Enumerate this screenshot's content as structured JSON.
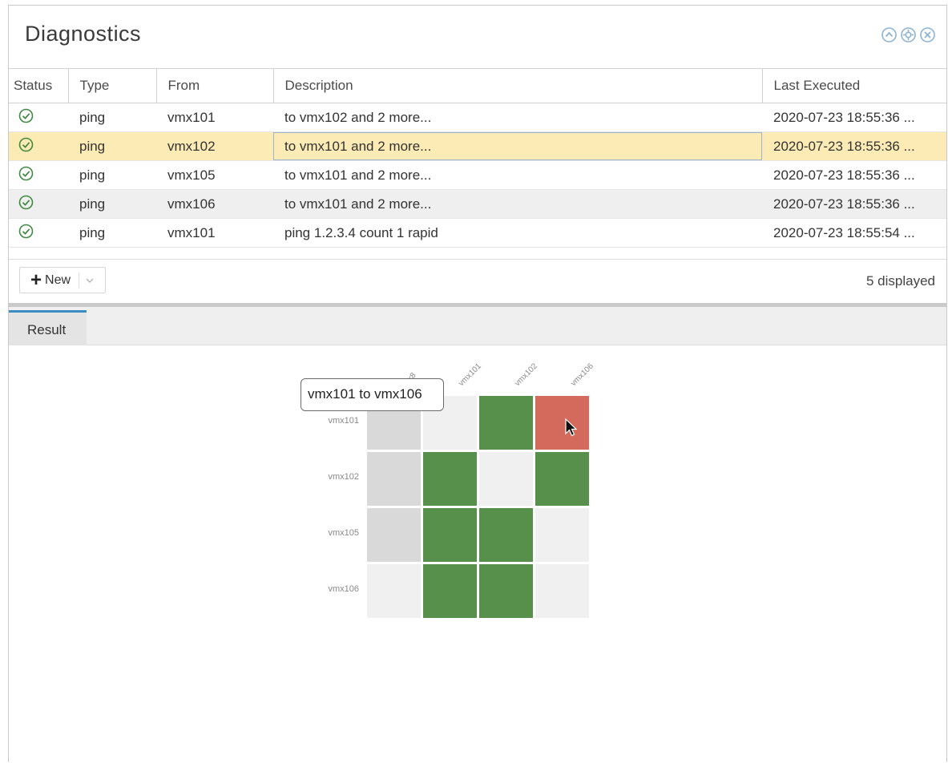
{
  "window": {
    "title": "Diagnostics"
  },
  "window_icons": [
    "collapse-icon",
    "gear-icon",
    "close-icon"
  ],
  "table": {
    "columns": [
      "Status",
      "Type",
      "From",
      "Description",
      "Last Executed"
    ],
    "rows": [
      {
        "status": "check-circle-icon",
        "type": "ping",
        "from": "vmx101",
        "description": "to vmx102 and 2 more...",
        "last_executed": "2020-07-23 18:55:36 ..."
      },
      {
        "status": "check-circle-icon",
        "type": "ping",
        "from": "vmx102",
        "description": "to vmx101 and 2 more...",
        "last_executed": "2020-07-23 18:55:36 ...",
        "selected": true
      },
      {
        "status": "check-circle-icon",
        "type": "ping",
        "from": "vmx105",
        "description": "to vmx101 and 2 more...",
        "last_executed": "2020-07-23 18:55:36 ..."
      },
      {
        "status": "check-circle-icon",
        "type": "ping",
        "from": "vmx106",
        "description": "to vmx101 and 2 more...",
        "last_executed": "2020-07-23 18:55:36 ..."
      },
      {
        "status": "check-circle-icon",
        "type": "ping",
        "from": "vmx101",
        "description": "ping 1.2.3.4 count 1 rapid",
        "last_executed": "2020-07-23 18:55:54 ..."
      }
    ]
  },
  "toolbar": {
    "new_label": "New",
    "count_text": "5 displayed"
  },
  "tabs": {
    "result_label": "Result"
  },
  "tooltip": {
    "text": "vmx101 to vmx106"
  },
  "colors": {
    "success": "#56904a",
    "failure": "#d46a5b",
    "self": "#f0f0f0",
    "inactive": "#d9d9d9",
    "selected_row": "#fcebb4",
    "accent": "#3a8cc2"
  },
  "chart_data": {
    "type": "heatmap",
    "columns": [
      "vmx8",
      "vmx101",
      "vmx102",
      "vmx106"
    ],
    "column_labels_visible": [
      "...x8",
      "vmx101",
      "vmx102",
      "vmx106"
    ],
    "rows": [
      "vmx101",
      "vmx102",
      "vmx105",
      "vmx106"
    ],
    "cells": [
      [
        "inactive",
        "self",
        "success",
        "failure"
      ],
      [
        "inactive",
        "success",
        "self",
        "success"
      ],
      [
        "inactive",
        "success",
        "success",
        "self"
      ],
      [
        "self",
        "success",
        "success",
        "self"
      ]
    ]
  }
}
